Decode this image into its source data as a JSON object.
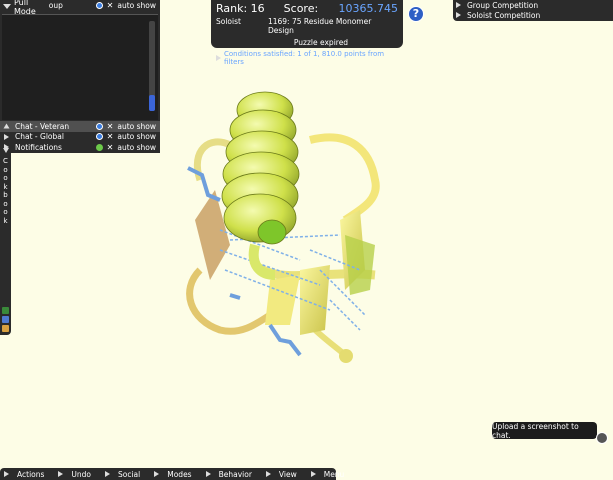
{
  "pull_mode": {
    "label": "Pull Mode"
  },
  "score_panel": {
    "rank_label": "Rank: 16",
    "score_label": "Score:",
    "score_value": "10365.745",
    "mode": "Soloist",
    "puzzle_name": "1169: 75 Residue Monomer Design",
    "status": "Puzzle expired",
    "conditions": "Conditions satisfied: 1 of 1, 810.0 points from filters"
  },
  "help": {
    "glyph": "?"
  },
  "competitions": [
    {
      "label": "Group Competition"
    },
    {
      "label": "Soloist Competition"
    }
  ],
  "cookbook": {
    "label": "Cookbook"
  },
  "bottom_menu": [
    {
      "label": "Actions"
    },
    {
      "label": "Undo"
    },
    {
      "label": "Social"
    },
    {
      "label": "Modes"
    },
    {
      "label": "Behavior"
    },
    {
      "label": "View"
    },
    {
      "label": "Menu"
    }
  ],
  "chat": {
    "group": {
      "label": "Chat - Group",
      "auto": "auto show"
    },
    "veteran": {
      "label": "Chat - Veteran",
      "auto": "auto show"
    },
    "global": {
      "label": "Chat - Global",
      "auto": "auto show"
    },
    "notifications": {
      "label": "Notifications",
      "auto": "auto show"
    },
    "tooltip": "Upload a screenshot to chat."
  },
  "colors": {
    "panel_bg": "#2b2b2b",
    "viewport_bg": "#fdfde6",
    "accent_blue": "#6aa5ff",
    "helix": "#dbe85a",
    "strand": "#f5ef78"
  }
}
